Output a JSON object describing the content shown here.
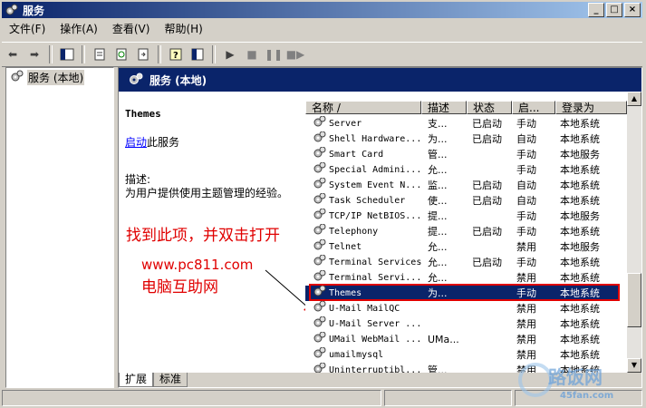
{
  "window": {
    "title": "服务",
    "controls": [
      "_",
      "□",
      "×"
    ]
  },
  "menubar": {
    "items": [
      "文件(F)",
      "操作(A)",
      "查看(V)",
      "帮助(H)"
    ]
  },
  "tree": {
    "root_label": "服务 (本地)"
  },
  "pane_header": {
    "title": "服务 (本地)"
  },
  "details": {
    "service_name": "Themes",
    "start_link": "启动",
    "start_suffix": "此服务",
    "desc_label": "描述:",
    "desc_text": "为用户提供使用主题管理的经验。"
  },
  "annotation": {
    "instruction": "找到此项，并双击打开",
    "site_url": "www.pc811.com",
    "site_name": "电脑互助网",
    "color": "#e00000"
  },
  "list": {
    "columns": [
      "名称 /",
      "描述",
      "状态",
      "启...",
      "登录为"
    ],
    "rows": [
      {
        "name": "Server",
        "desc": "支...",
        "status": "已启动",
        "start": "手动",
        "logon": "本地系统"
      },
      {
        "name": "Shell Hardware...",
        "desc": "为...",
        "status": "已启动",
        "start": "自动",
        "logon": "本地系统"
      },
      {
        "name": "Smart Card",
        "desc": "管...",
        "status": "",
        "start": "手动",
        "logon": "本地服务"
      },
      {
        "name": "Special Admini...",
        "desc": "允...",
        "status": "",
        "start": "手动",
        "logon": "本地系统"
      },
      {
        "name": "System Event N...",
        "desc": "监...",
        "status": "已启动",
        "start": "自动",
        "logon": "本地系统"
      },
      {
        "name": "Task Scheduler",
        "desc": "使...",
        "status": "已启动",
        "start": "自动",
        "logon": "本地系统"
      },
      {
        "name": "TCP/IP NetBIOS...",
        "desc": "提...",
        "status": "",
        "start": "手动",
        "logon": "本地服务"
      },
      {
        "name": "Telephony",
        "desc": "提...",
        "status": "已启动",
        "start": "手动",
        "logon": "本地系统"
      },
      {
        "name": "Telnet",
        "desc": "允...",
        "status": "",
        "start": "禁用",
        "logon": "本地服务"
      },
      {
        "name": "Terminal Services",
        "desc": "允...",
        "status": "已启动",
        "start": "手动",
        "logon": "本地系统"
      },
      {
        "name": "Terminal Servi...",
        "desc": "允...",
        "status": "",
        "start": "禁用",
        "logon": "本地系统"
      },
      {
        "name": "Themes",
        "desc": "为...",
        "status": "",
        "start": "手动",
        "logon": "本地系统",
        "selected": true
      },
      {
        "name": "U-Mail MailQC",
        "desc": "",
        "status": "",
        "start": "禁用",
        "logon": "本地系统"
      },
      {
        "name": "U-Mail Server ...",
        "desc": "",
        "status": "",
        "start": "禁用",
        "logon": "本地系统"
      },
      {
        "name": "UMail WebMail ...",
        "desc": "UMa...",
        "status": "",
        "start": "禁用",
        "logon": "本地系统"
      },
      {
        "name": "umailmysql",
        "desc": "",
        "status": "",
        "start": "禁用",
        "logon": "本地系统"
      },
      {
        "name": "Uninterruptibl...",
        "desc": "管...",
        "status": "",
        "start": "禁用",
        "logon": "本地系统"
      }
    ]
  },
  "tabs": [
    "扩展",
    "标准"
  ],
  "watermark": {
    "text": "路饭网",
    "domain": "45fan.com"
  }
}
